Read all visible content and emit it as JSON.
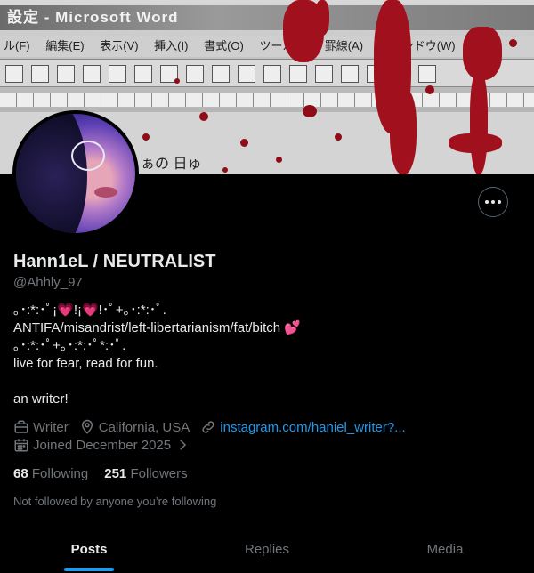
{
  "banner": {
    "window_title": "設定 - Microsoft Word",
    "menu_items": [
      "ル(F)",
      "編集(E)",
      "表示(V)",
      "挿入(I)",
      "書式(O)",
      "ツール(T)",
      "罫線(A)",
      "ウィンドウ(W)"
    ],
    "page_text": "ぁの 日ゅ"
  },
  "profile": {
    "name": "Hann1eL / NEUTRALIST",
    "handle": "@Ahhly_97",
    "bio_lines": [
      "｡･:*:･ﾟ¡💗!¡💗!･ﾟ+｡･:*:･ﾟ.",
      "ANTIFA/misandrist/left-libertarianism/fat/bitch 💕",
      "｡･:*:･ﾟ+｡･:*:･ﾟ*:･ﾟ.",
      "live for fear, read for fun.",
      "",
      "an writer!"
    ],
    "occupation": "Writer",
    "location": "California, USA",
    "website": "instagram.com/haniel_writer?...",
    "joined": "Joined December 2025",
    "following_count": "68",
    "following_label": "Following",
    "followers_count": "251",
    "followers_label": "Followers",
    "not_followed": "Not followed by anyone you’re following"
  },
  "tabs": [
    "Posts",
    "Replies",
    "Media"
  ],
  "colors": {
    "background": "#000000",
    "text_primary": "#e7e9ea",
    "text_secondary": "#71767b",
    "accent": "#1d9bf0"
  },
  "icons": [
    "more-icon",
    "briefcase-icon",
    "location-pin-icon",
    "link-icon",
    "calendar-icon",
    "chevron-right-icon"
  ]
}
